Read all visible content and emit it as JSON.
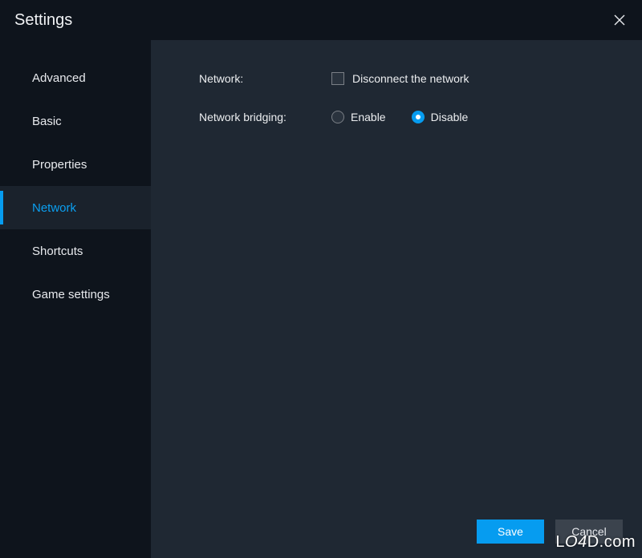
{
  "titlebar": {
    "title": "Settings"
  },
  "sidebar": {
    "items": [
      {
        "label": "Advanced",
        "selected": false
      },
      {
        "label": "Basic",
        "selected": false
      },
      {
        "label": "Properties",
        "selected": false
      },
      {
        "label": "Network",
        "selected": true
      },
      {
        "label": "Shortcuts",
        "selected": false
      },
      {
        "label": "Game settings",
        "selected": false
      }
    ]
  },
  "form": {
    "network_label": "Network:",
    "disconnect_label": "Disconnect the network",
    "disconnect_checked": false,
    "bridging_label": "Network bridging:",
    "enable_label": "Enable",
    "disable_label": "Disable",
    "bridging_value": "disable"
  },
  "buttons": {
    "save": "Save",
    "cancel": "Cancel"
  },
  "watermark": "LO4D.com"
}
